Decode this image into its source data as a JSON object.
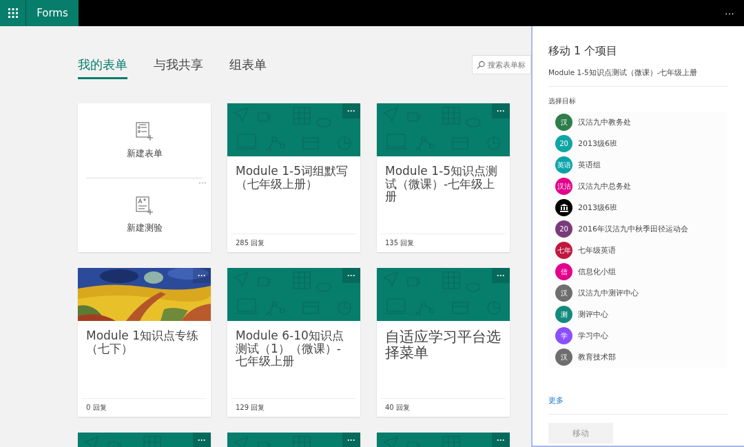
{
  "app_bar": {
    "title": "Forms",
    "more": "···"
  },
  "tabs": [
    {
      "label": "我的表单",
      "selected": true
    },
    {
      "label": "与我共享",
      "selected": false
    },
    {
      "label": "组表单",
      "selected": false
    }
  ],
  "search": {
    "placeholder": "搜索表单标"
  },
  "new_card": {
    "actions": [
      {
        "kind": "form",
        "label": "新建表单"
      },
      {
        "kind": "quiz",
        "label": "新建测验"
      }
    ],
    "more": "···"
  },
  "cards": [
    {
      "kind": "pattern",
      "title": "Module 1-5词组默写（七年级上册）",
      "responses": "285 回复",
      "more": "···"
    },
    {
      "kind": "pattern",
      "title": "Module 1-5知识点测试（微课）-七年级上册",
      "responses": "135 回复",
      "more": "···"
    },
    {
      "kind": "picture",
      "title": "Module 1知识点专练（七下）",
      "responses": "0 回复",
      "more": "···"
    },
    {
      "kind": "pattern",
      "title": "Module 6-10知识点测试（1）（微课）-七年级上册",
      "responses": "129 回复",
      "more": "···"
    },
    {
      "kind": "pattern",
      "title": "自适应学习平台选择菜单",
      "responses": "40 回复",
      "more": "···"
    },
    {
      "kind": "pattern",
      "more": "···"
    },
    {
      "kind": "pattern",
      "more": "···"
    },
    {
      "kind": "pattern",
      "more": "···"
    }
  ],
  "panel": {
    "title": "移动 1 个项目",
    "subtitle": "Module 1-5知识点测试（微课）-七年级上册",
    "section": "选择目标",
    "groups": [
      {
        "kind": "initials",
        "initials": "汉",
        "color": "#2e7d4a",
        "name": "汉沽九中教务处"
      },
      {
        "kind": "initials",
        "initials": "20",
        "color": "#0fa5a5",
        "name": "2013级6班"
      },
      {
        "kind": "initials",
        "initials": "英语",
        "color": "#0ba3a8",
        "name": "英语组"
      },
      {
        "kind": "initials",
        "initials": "汉沽",
        "color": "#e3008c",
        "name": "汉沽九中总务处"
      },
      {
        "kind": "icon",
        "color": "#000000",
        "name": "2013级6班"
      },
      {
        "kind": "initials",
        "initials": "20",
        "color": "#7a3b7a",
        "name": "2016年汉沽九中秋季田径运动会"
      },
      {
        "kind": "initials",
        "initials": "七年",
        "color": "#c0183f",
        "name": "七年级英语"
      },
      {
        "kind": "initials",
        "initials": "信",
        "color": "#e3008c",
        "name": "信息化小组"
      },
      {
        "kind": "initials",
        "initials": "汉",
        "color": "#6e6e6e",
        "name": "汉沽九中测评中心"
      },
      {
        "kind": "initials",
        "initials": "测",
        "color": "#138a7e",
        "name": "测评中心"
      },
      {
        "kind": "initials",
        "initials": "学",
        "color": "#8a4fff",
        "name": "学习中心"
      },
      {
        "kind": "initials",
        "initials": "汉",
        "color": "#6e6e6e",
        "name": "教育技术部"
      }
    ],
    "more_link": "更多",
    "move_button": {
      "label": "移动",
      "disabled": true
    }
  }
}
